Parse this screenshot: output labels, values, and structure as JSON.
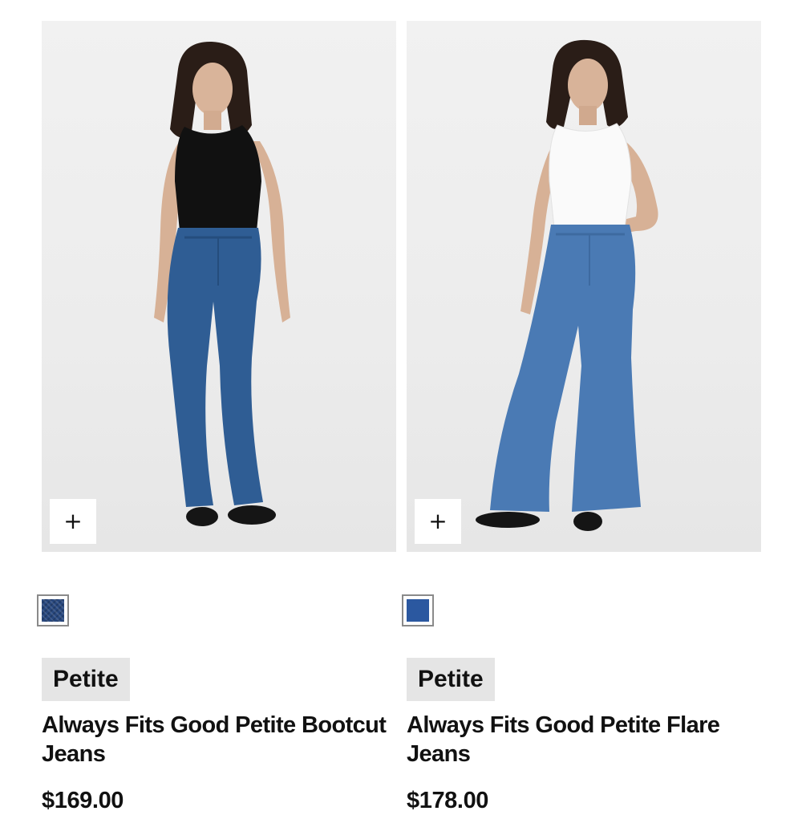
{
  "products": [
    {
      "badge": "Petite",
      "title": "Always Fits Good Petite Bootcut Jeans",
      "price": "$169.00",
      "quick_add_icon": "plus-icon",
      "swatch_color": "#27477e",
      "top_color": "#111111",
      "denim_color": "#2f5d94"
    },
    {
      "badge": "Petite",
      "title": "Always Fits Good Petite Flare Jeans",
      "price": "$178.00",
      "quick_add_icon": "plus-icon",
      "swatch_color": "#2b58a0",
      "top_color": "#ffffff",
      "denim_color": "#4a7ab4"
    }
  ]
}
